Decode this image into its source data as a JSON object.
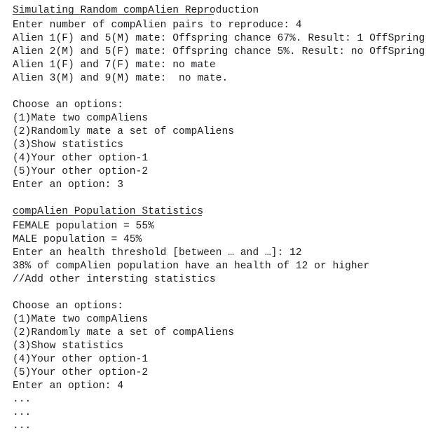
{
  "console": {
    "title_section": {
      "heading": "Simulating Random compAlien Reproduction",
      "rule": true
    },
    "reproduction_section": {
      "prompt_pairs": "Enter number of compAlien pairs to reproduce: 4",
      "results": [
        "Alien 1(F) and 5(M) mate: Offspring chance 67%. Result: 1 OffSpring",
        "Alien 2(M) and 5(F) mate: Offspring chance 5%. Result: no OffSpring",
        "Alien 1(F) and 7(F) mate: no mate",
        "Alien 3(M) and 9(M) mate:  no mate."
      ]
    },
    "menu_first": {
      "prompt": "Choose an options:",
      "options": [
        "(1)Mate two compAliens",
        "(2)Randomly mate a set of compAliens",
        "(3)Show statistics",
        "(4)Your other option-1",
        "(5)Your other option-2"
      ],
      "entry": "Enter an option: 3"
    },
    "statistics_section": {
      "heading": "compAlien Population Statistics",
      "rule": true,
      "lines": [
        "FEMALE population = 55%",
        "MALE population = 45%",
        "Enter an health threshold [between … and …]: 12",
        "38% of compAlien population have an health of 12 or higher",
        "//Add other intersting statistics"
      ]
    },
    "menu_second": {
      "prompt": "Choose an options:",
      "options": [
        "(1)Mate two compAliens",
        "(2)Randomly mate a set of compAliens",
        "(3)Show statistics",
        "(4)Your other option-1",
        "(5)Your other option-2"
      ],
      "entry": "Enter an option: 4"
    },
    "trailing": [
      "...",
      "...",
      "..."
    ],
    "colors": {
      "background": "#ffffff",
      "text": "#1c1c20",
      "rule": "#4a4a52"
    }
  }
}
